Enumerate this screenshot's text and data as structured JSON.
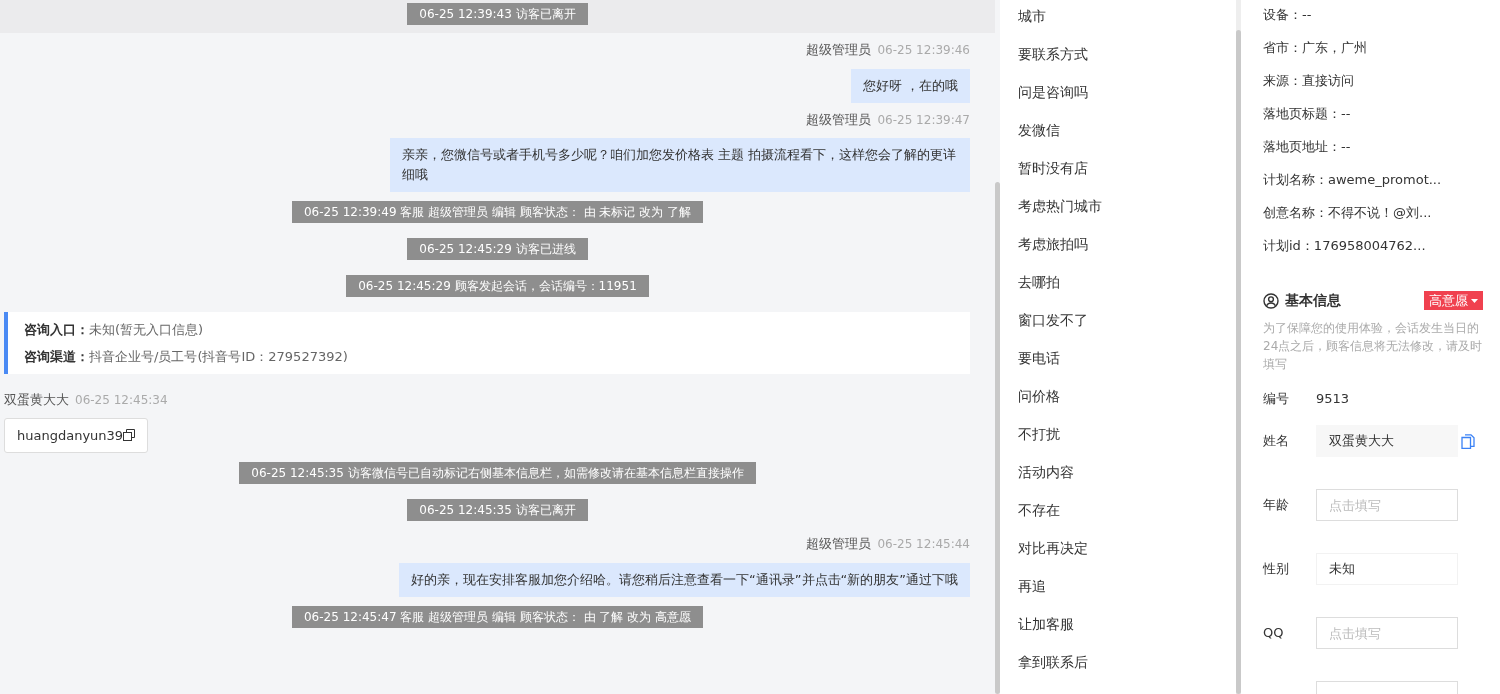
{
  "chat": {
    "top_notice": "06-25 12:39:43 访客已离开",
    "messages": [
      {
        "kind": "agent",
        "sender": "超级管理员",
        "time": "06-25 12:39:46",
        "text": "您好呀 ，在的哦"
      },
      {
        "kind": "agent",
        "sender": "超级管理员",
        "time": "06-25 12:39:47",
        "text": "亲亲，您微信号或者手机号多少呢？咱们加您发价格表 主题 拍摄流程看下，这样您会了解的更详细哦"
      },
      {
        "kind": "system",
        "text": "06-25 12:39:49 客服 超级管理员 编辑 顾客状态： 由 未标记 改为 了解"
      },
      {
        "kind": "system",
        "text": "06-25 12:45:29 访客已进线"
      },
      {
        "kind": "system",
        "text": "06-25 12:45:29 顾客发起会话，会话编号：11951"
      },
      {
        "kind": "info",
        "rows": [
          {
            "label": "咨询入口：",
            "value": "未知(暂无入口信息)"
          },
          {
            "label": "咨询渠道：",
            "value": "抖音企业号/员工号(抖音号ID：279527392)"
          }
        ]
      },
      {
        "kind": "visitor",
        "sender": "双蛋黄大大",
        "time": "06-25 12:45:34",
        "text": "huangdanyun39"
      },
      {
        "kind": "system",
        "text": "06-25 12:45:35 访客微信号已自动标记右侧基本信息栏，如需修改请在基本信息栏直接操作"
      },
      {
        "kind": "system",
        "text": "06-25 12:45:35 访客已离开"
      },
      {
        "kind": "agent",
        "sender": "超级管理员",
        "time": "06-25 12:45:44",
        "text": "好的亲，现在安排客服加您介绍哈。请您稍后注意查看一下“通讯录”并点击“新的朋友”通过下哦"
      },
      {
        "kind": "system",
        "text": "06-25 12:45:47 客服 超级管理员 编辑 顾客状态： 由 了解 改为 高意愿"
      }
    ]
  },
  "quick_replies": [
    "城市",
    "要联系方式",
    "问是咨询吗",
    "发微信",
    "暂时没有店",
    "考虑热门城市",
    "考虑旅拍吗",
    "去哪拍",
    "窗口发不了",
    "要电话",
    "问价格",
    "不打扰",
    "活动内容",
    "不存在",
    "对比再决定",
    "再追",
    "让加客服",
    "拿到联系后"
  ],
  "visitor_info": [
    "设备：--",
    "省市：广东，广州",
    "来源：直接访问",
    "落地页标题：--",
    "落地页地址：--",
    "计划名称：aweme_promot...",
    "创意名称：不得不说！@刘...",
    "计划id：176958004762..."
  ],
  "basic_info": {
    "title": "基本信息",
    "intent": "高意愿",
    "notice": "为了保障您的使用体验，会话发生当日的24点之后，顾客信息将无法修改，请及时填写",
    "fields": [
      {
        "kind": "text",
        "label": "编号",
        "value": "9513"
      },
      {
        "kind": "filled",
        "label": "姓名",
        "value": "双蛋黄大大"
      },
      {
        "kind": "input",
        "label": "年龄",
        "placeholder": "点击填写"
      },
      {
        "kind": "input",
        "label": "性别",
        "value": "未知"
      },
      {
        "kind": "input",
        "label": "QQ",
        "placeholder": "点击填写"
      },
      {
        "kind": "input"
      }
    ]
  }
}
